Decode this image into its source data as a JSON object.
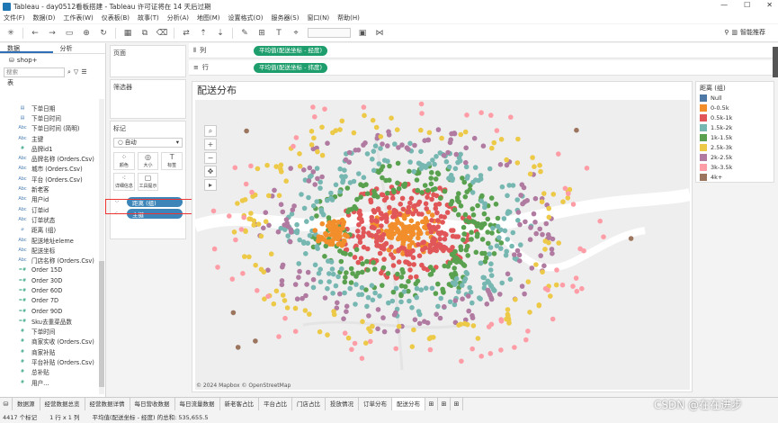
{
  "window": {
    "title": "Tableau - day0512看板搭建 - Tableau 许可证将在 14 天后过期"
  },
  "menu": [
    "文件(F)",
    "数据(D)",
    "工作表(W)",
    "仪表板(B)",
    "故事(T)",
    "分析(A)",
    "地图(M)",
    "设置格式(O)",
    "服务器(S)",
    "窗口(N)",
    "帮助(H)"
  ],
  "toolbar": {
    "smart_recommend": "智能推荐"
  },
  "left_pane": {
    "tabs": [
      "数据",
      "分析"
    ],
    "datasource": "shop+",
    "search_placeholder": "搜索",
    "section": "表",
    "fields": [
      {
        "icon": "cal",
        "name": "下单日期"
      },
      {
        "icon": "cal",
        "name": "下单日时间"
      },
      {
        "icon": "Abc",
        "name": "下单日时间 (简明)"
      },
      {
        "icon": "Abc",
        "name": "主键"
      },
      {
        "icon": "#",
        "name": "品牌id1"
      },
      {
        "icon": "Abc",
        "name": "品牌名称 (Orders.Csv)"
      },
      {
        "icon": "Abc",
        "name": "城市 (Orders.Csv)"
      },
      {
        "icon": "Abc",
        "name": "平台 (Orders.Csv)"
      },
      {
        "icon": "Abc",
        "name": "新老客"
      },
      {
        "icon": "Abc",
        "name": "用户id"
      },
      {
        "icon": "Abc",
        "name": "订单id"
      },
      {
        "icon": "Abc",
        "name": "订单状态"
      },
      {
        "icon": "grp",
        "name": "距离 (组)"
      },
      {
        "icon": "Abc",
        "name": "配送地址eleme"
      },
      {
        "icon": "Abc",
        "name": "配送坐标"
      },
      {
        "icon": "Abc",
        "name": "门店名称 (Orders.Csv)"
      },
      {
        "icon": "=#",
        "name": "Order 15D"
      },
      {
        "icon": "=#",
        "name": "Order 30D"
      },
      {
        "icon": "=#",
        "name": "Order 60D"
      },
      {
        "icon": "=#",
        "name": "Order 7D"
      },
      {
        "icon": "=#",
        "name": "Order 90D"
      },
      {
        "icon": "=#",
        "name": "Sku去重菜品数"
      },
      {
        "icon": "#",
        "name": "下单时间"
      },
      {
        "icon": "#",
        "name": "商家实收 (Orders.Csv)"
      },
      {
        "icon": "#",
        "name": "商家补贴"
      },
      {
        "icon": "#",
        "name": "平台补贴 (Orders.Csv)"
      },
      {
        "icon": "#",
        "name": "总补贴"
      },
      {
        "icon": "#",
        "name": "用户…"
      }
    ]
  },
  "cards": {
    "pages": "页面",
    "filters": "筛选器",
    "marks": "标记",
    "mark_type": "自动",
    "mark_buttons": [
      "颜色",
      "大小",
      "标签",
      "详细信息",
      "工具提示"
    ],
    "pills": [
      {
        "icon": "color",
        "label": "距离 (组)"
      },
      {
        "icon": "detail",
        "label": "主键"
      }
    ]
  },
  "shelves": {
    "columns_label": "列",
    "columns_pill": "平均值(配送坐标 - 经度)",
    "rows_label": "行",
    "rows_pill": "平均值(配送坐标 - 纬度)"
  },
  "view": {
    "title": "配送分布",
    "attribution": "© 2024 Mapbox © OpenStreetMap"
  },
  "legend": {
    "title": "距离 (组)",
    "items": [
      {
        "label": "Null",
        "color": "#4e79a7"
      },
      {
        "label": "0-0.5k",
        "color": "#f28e2b"
      },
      {
        "label": "0.5k-1k",
        "color": "#e15759"
      },
      {
        "label": "1.5k-2k",
        "color": "#76b7b2"
      },
      {
        "label": "1k-1.5k",
        "color": "#59a14f"
      },
      {
        "label": "2.5k-3k",
        "color": "#edc948"
      },
      {
        "label": "2k-2.5k",
        "color": "#b07aa1"
      },
      {
        "label": "3k-3.5k",
        "color": "#ff9da7"
      },
      {
        "label": "4k+",
        "color": "#9c755f"
      }
    ]
  },
  "sheet_tabs": [
    {
      "label": "数据源",
      "active": false
    },
    {
      "label": "经营数据总览",
      "active": false
    },
    {
      "label": "经营数据详情",
      "active": false
    },
    {
      "label": "每日营收数据",
      "active": false
    },
    {
      "label": "每日流量数据",
      "active": false
    },
    {
      "label": "新老客占比",
      "active": false
    },
    {
      "label": "平台占比",
      "active": false
    },
    {
      "label": "门店占比",
      "active": false
    },
    {
      "label": "投放情况",
      "active": false
    },
    {
      "label": "订单分布",
      "active": false
    },
    {
      "label": "配送分布",
      "active": true
    }
  ],
  "status": {
    "marks": "4417 个标记",
    "rowscols": "1 行 x 1 列",
    "sum": "平均值(配送坐标 - 经度) 的总和: 535,655.5"
  },
  "watermark": "CSDN @在在进步"
}
